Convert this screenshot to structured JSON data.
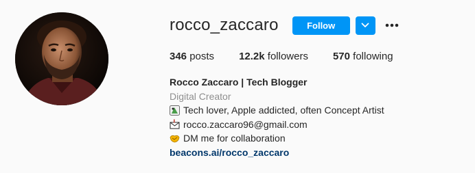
{
  "profile": {
    "username": "rocco_zaccaro",
    "follow_label": "Follow",
    "dropdown_icon": "chevron-down-icon",
    "more_icon": "more-options-icon",
    "stats": {
      "posts_count": "346",
      "posts_label": "posts",
      "followers_count": "12.2k",
      "followers_label": "followers",
      "following_count": "570",
      "following_label": "following"
    },
    "bio": {
      "full_name": "Rocco Zaccaro | Tech Blogger",
      "category": "Digital Creator",
      "lines": [
        {
          "icon": "artist-palette-emoji",
          "text": "Tech lover, Apple addicted, often Concept Artist"
        },
        {
          "icon": "mailbox-emoji",
          "text": "rocco.zaccaro96@gmail.com"
        },
        {
          "icon": "handshake-emoji",
          "text": "DM me for collaboration"
        }
      ],
      "link": "beacons.ai/rocco_zaccaro"
    }
  },
  "colors": {
    "background": "#fafafa",
    "primary_button": "#0095f6",
    "link": "#00376b",
    "secondary_text": "#8e8e8e",
    "text": "#262626"
  }
}
